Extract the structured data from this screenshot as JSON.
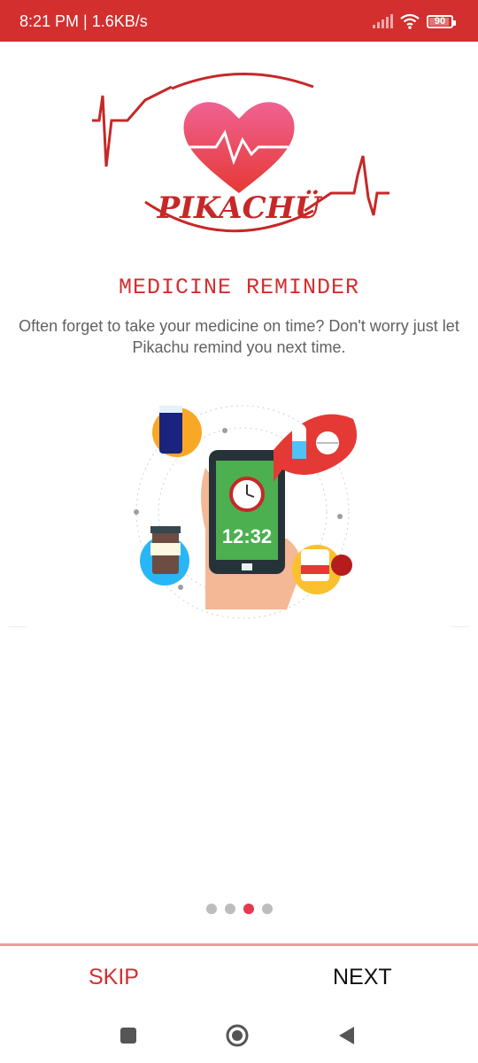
{
  "status_bar": {
    "time_speed": "8:21 PM | 1.6KB/s",
    "battery": "90"
  },
  "logo": {
    "brand_text": "PIKACHÜ"
  },
  "onboarding": {
    "title": "MEDICINE REMINDER",
    "description": "Often forget to take your medicine on time? Don't worry just let Pikachu remind you next time.",
    "illustration_clock_time": "12:32",
    "page_indicator": {
      "total": 4,
      "active_index": 2
    }
  },
  "footer": {
    "skip_label": "SKIP",
    "next_label": "NEXT"
  },
  "colors": {
    "accent": "#d32f2f",
    "active_dot": "#e5394e",
    "inactive_dot": "#bdbdbd"
  },
  "icons": {
    "signal": "signal-icon",
    "wifi": "wifi-icon",
    "battery": "battery-icon",
    "nav_recent": "square-icon",
    "nav_home": "circle-icon",
    "nav_back": "triangle-back-icon"
  }
}
